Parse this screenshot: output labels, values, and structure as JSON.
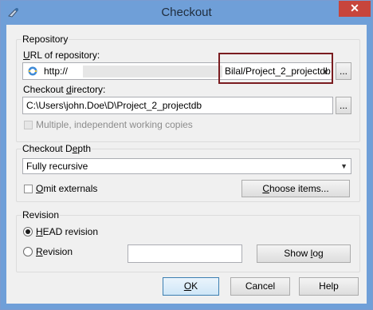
{
  "window": {
    "title": "Checkout",
    "close_glyph": "✕"
  },
  "repository": {
    "group_label": "Repository",
    "url_label": "URL of repository:",
    "url_prefix": "http://",
    "url_combo_value": "Bilal/Project_2_projectdb",
    "browse_label": "...",
    "checkout_dir_label": "Checkout directory:",
    "checkout_dir_value": "C:\\Users\\john.Doe\\D\\Project_2_projectdb",
    "dir_browse_label": "...",
    "multiple_label": "Multiple, independent working copies"
  },
  "depth": {
    "group_label": "Checkout Depth",
    "selected": "Fully recursive",
    "omit_externals_label": "Omit externals",
    "choose_items_label": "Choose items..."
  },
  "revision": {
    "group_label": "Revision",
    "head_label": "HEAD revision",
    "revision_label": "Revision",
    "revision_value": "",
    "show_log_label": "Show log"
  },
  "buttons": {
    "ok": "OK",
    "cancel": "Cancel",
    "help": "Help"
  }
}
